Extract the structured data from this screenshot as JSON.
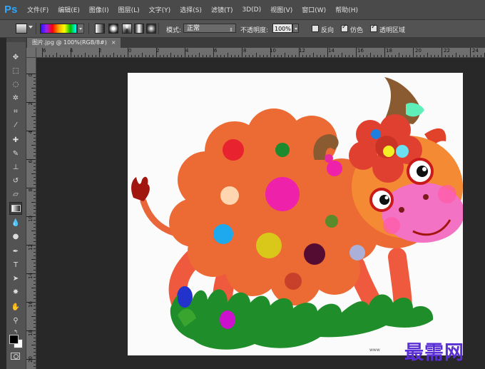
{
  "app": {
    "logo": "Ps"
  },
  "menu": [
    "文件(F)",
    "编辑(E)",
    "图像(I)",
    "图层(L)",
    "文字(Y)",
    "选择(S)",
    "滤镜(T)",
    "3D(D)",
    "视图(V)",
    "窗口(W)",
    "帮助(H)"
  ],
  "options": {
    "mode_label": "模式:",
    "mode_value": "正常",
    "opacity_label": "不透明度:",
    "opacity_value": "100%",
    "reverse_label": "反向",
    "reverse_checked": false,
    "dither_label": "仿色",
    "dither_checked": true,
    "transparency_label": "透明区域",
    "transparency_checked": true
  },
  "document": {
    "tab_title": "图片.jpg @ 100%(RGB/8#)",
    "close": "×"
  },
  "ruler": {
    "h_labels": [
      "6",
      "4",
      "2",
      "0",
      "2",
      "4",
      "6",
      "8",
      "10",
      "12",
      "14",
      "16",
      "18",
      "20",
      "22",
      "24"
    ],
    "v_labels": [
      "0",
      "2",
      "4",
      "6",
      "8",
      "10",
      "12",
      "14",
      "16",
      "18",
      "20"
    ]
  },
  "tools": [
    "move-tool",
    "marquee-tool",
    "lasso-tool",
    "magic-wand-tool",
    "crop-tool",
    "eyedropper-tool",
    "healing-brush-tool",
    "brush-tool",
    "clone-stamp-tool",
    "history-brush-tool",
    "eraser-tool",
    "gradient-tool",
    "blur-tool",
    "dodge-tool",
    "pen-tool",
    "type-tool",
    "path-selection-tool",
    "shape-tool",
    "hand-tool",
    "zoom-tool"
  ],
  "active_tool": "gradient-tool",
  "colors": {
    "foreground": "#000000",
    "background": "#ffffff",
    "accent": "#2ea6ff",
    "watermark": "#5b2fd6"
  },
  "watermark": {
    "text": "最需网",
    "small": "www"
  }
}
